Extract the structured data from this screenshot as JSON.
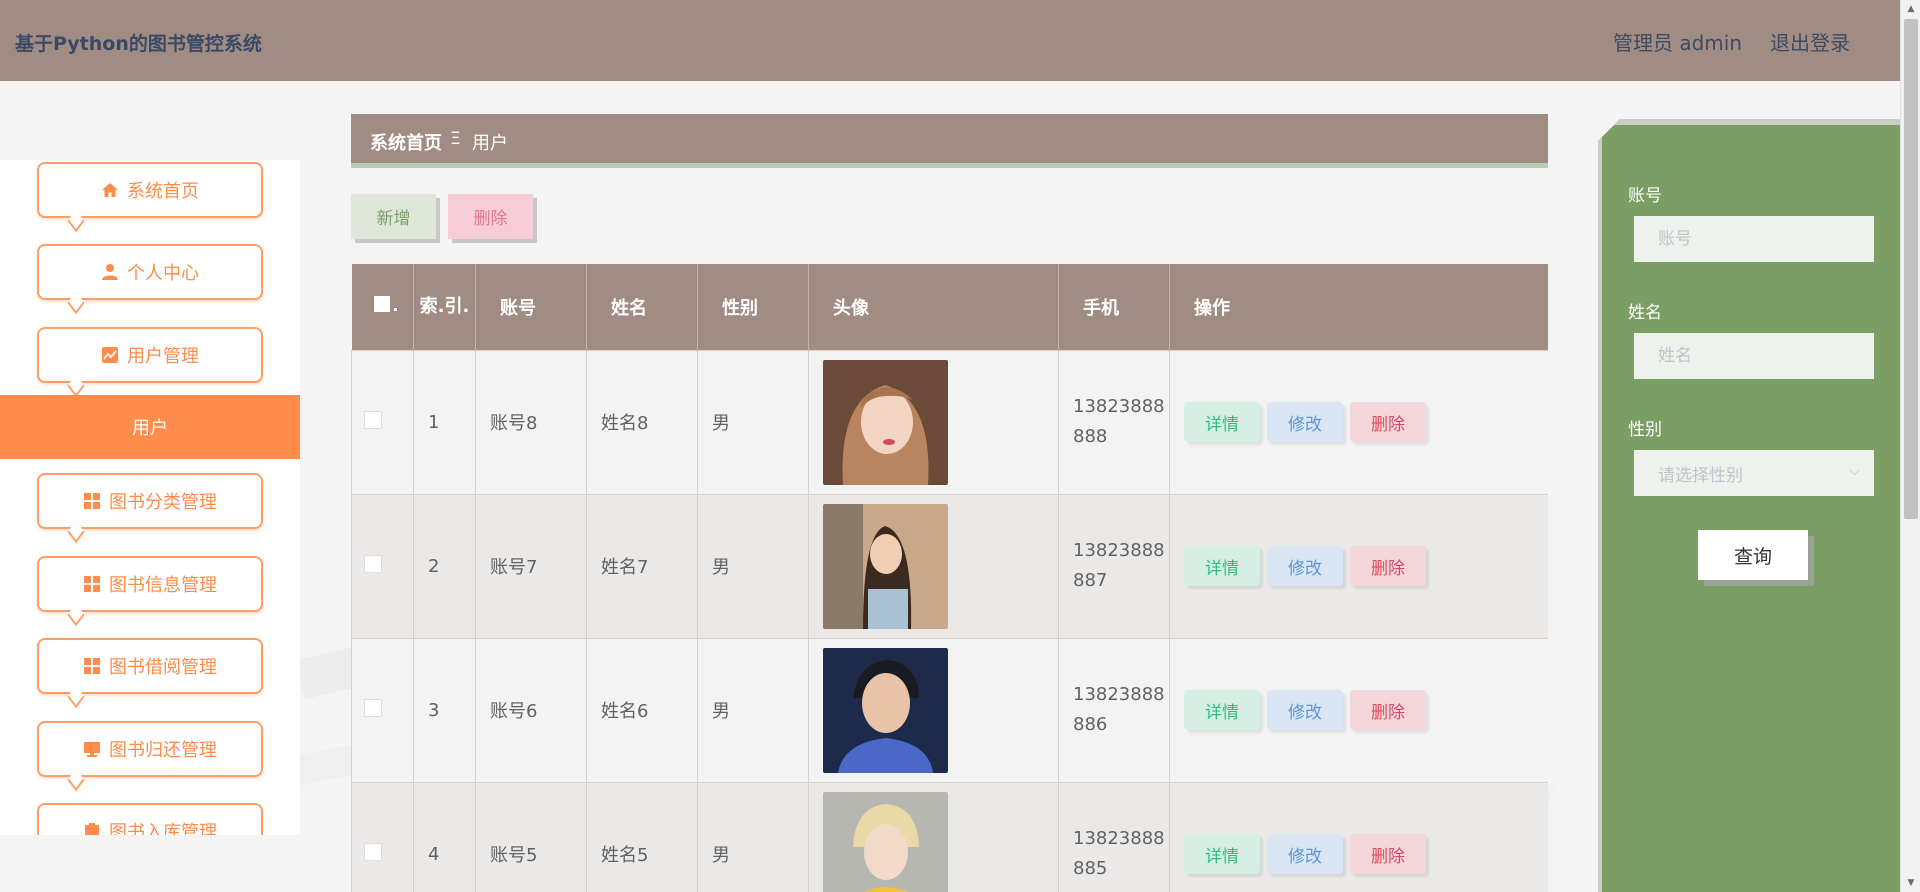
{
  "header": {
    "title": "基于Python的图书管控系统",
    "user": "管理员 admin",
    "logout": "退出登录"
  },
  "sidebar": {
    "items": [
      {
        "label": "系统首页",
        "icon": "home-icon"
      },
      {
        "label": "个人中心",
        "icon": "user-icon"
      },
      {
        "label": "用户管理",
        "icon": "chart-icon"
      },
      {
        "label": "图书分类管理",
        "icon": "grid-icon"
      },
      {
        "label": "图书信息管理",
        "icon": "grid-icon"
      },
      {
        "label": "图书借阅管理",
        "icon": "grid-icon"
      },
      {
        "label": "图书归还管理",
        "icon": "monitor-icon"
      },
      {
        "label": "图书入库管理",
        "icon": "clipboard-icon"
      }
    ],
    "active_label": "用户"
  },
  "breadcrumb": {
    "home": "系统首页",
    "separator": "Ξ",
    "current": "用户"
  },
  "actions": {
    "add": "新增",
    "delete": "删除"
  },
  "table": {
    "headers": {
      "index": "索.引.",
      "account": "账号",
      "name": "姓名",
      "gender": "性别",
      "avatar": "头像",
      "phone": "手机",
      "ops": "操作"
    },
    "rows": [
      {
        "index": "1",
        "account": "账号8",
        "name": "姓名8",
        "gender": "男",
        "phone1": "13823888",
        "phone2": "888"
      },
      {
        "index": "2",
        "account": "账号7",
        "name": "姓名7",
        "gender": "男",
        "phone1": "13823888",
        "phone2": "887"
      },
      {
        "index": "3",
        "account": "账号6",
        "name": "姓名6",
        "gender": "男",
        "phone1": "13823888",
        "phone2": "886"
      },
      {
        "index": "4",
        "account": "账号5",
        "name": "姓名5",
        "gender": "男",
        "phone1": "13823888",
        "phone2": "885"
      }
    ],
    "op_labels": {
      "detail": "详情",
      "edit": "修改",
      "delete": "删除"
    }
  },
  "filter": {
    "account_label": "账号",
    "account_placeholder": "账号",
    "name_label": "姓名",
    "name_placeholder": "姓名",
    "gender_label": "性别",
    "gender_placeholder": "请选择性别",
    "query": "查询"
  },
  "colors": {
    "header_bg": "#a08c83",
    "accent": "#ff8c4a",
    "filter_bg": "#7a9e63"
  }
}
